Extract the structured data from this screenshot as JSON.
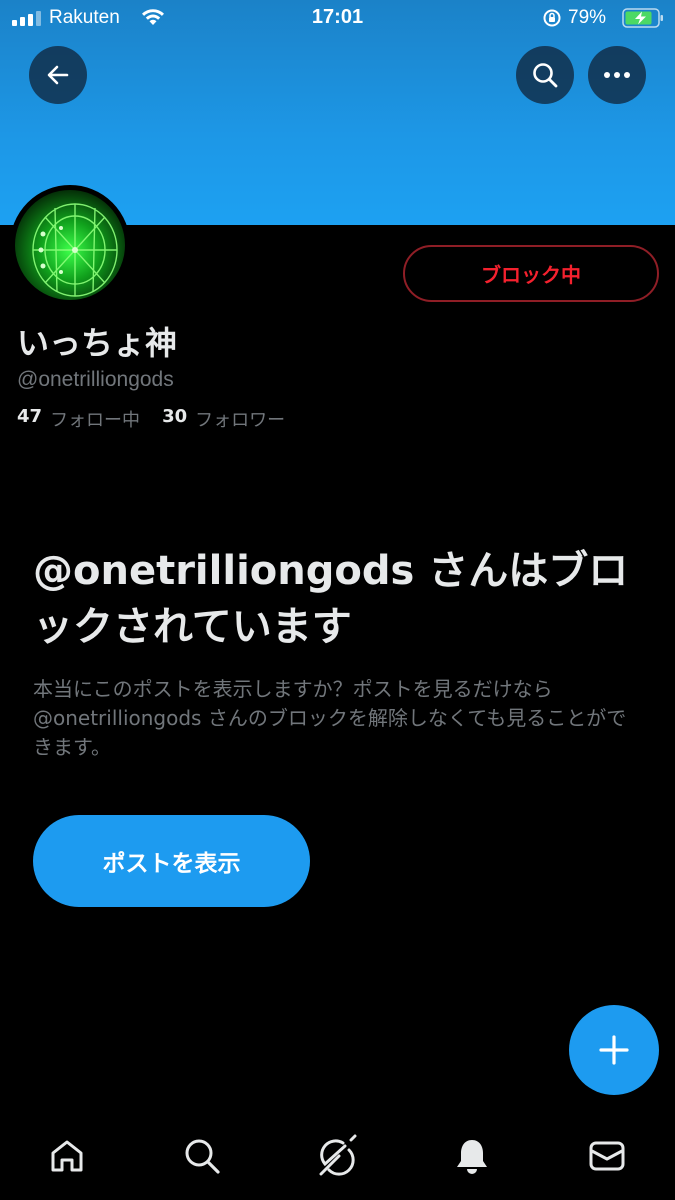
{
  "status_bar": {
    "carrier": "Rakuten",
    "time": "17:01",
    "battery_percent": "79%"
  },
  "profile": {
    "display_name": "いっちょ神",
    "handle": "@onetrilliongods",
    "following_count": "47",
    "following_label": "フォロー中",
    "followers_count": "30",
    "followers_label": "フォロワー",
    "block_button_label": "ブロック中"
  },
  "blocked_notice": {
    "headline": "@onetrilliongods さんはブロックされています",
    "description": "本当にこのポストを表示しますか？ポストを見るだけなら @onetrilliongods さんのブロックを解除しなくても見ることができます。",
    "show_posts_label": "ポストを表示"
  },
  "colors": {
    "banner": "#1d9bf0",
    "accent": "#1d9bf0",
    "block_red": "#f4212e",
    "background": "#000000",
    "secondary_text": "#71767b"
  },
  "icons": {
    "back": "arrow-left-icon",
    "search": "search-icon",
    "more": "more-horizontal-icon",
    "compose": "plus-icon",
    "tabs": [
      "home-icon",
      "search-icon",
      "grok-icon",
      "bell-icon",
      "mail-icon"
    ]
  }
}
